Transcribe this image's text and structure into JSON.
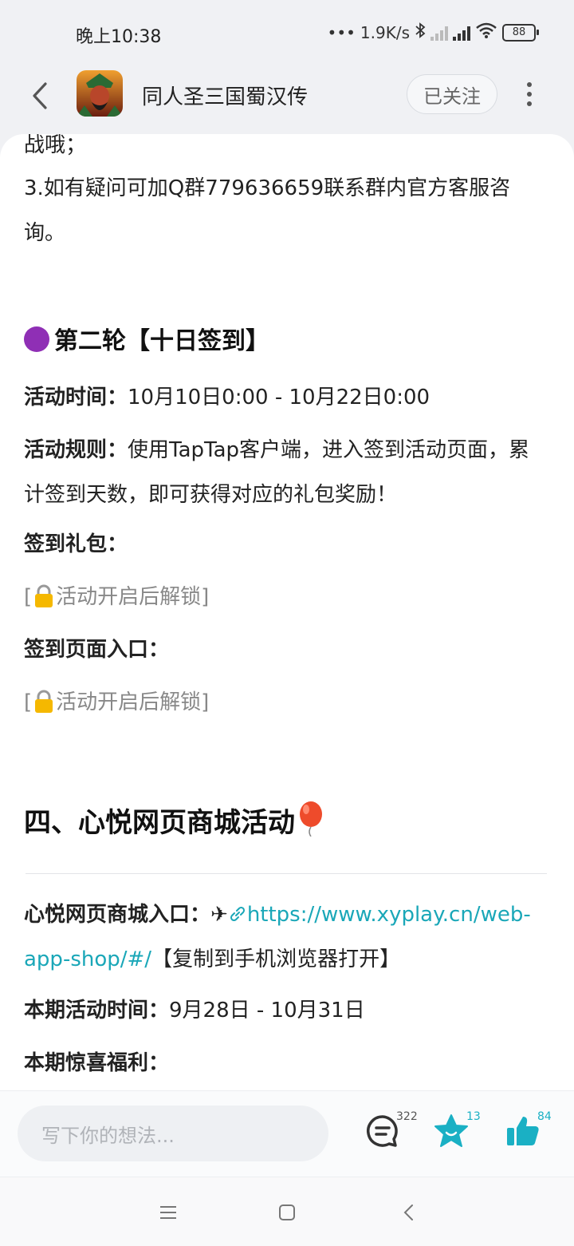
{
  "status_bar": {
    "time": "晚上10:38",
    "network_speed": "1.9K/s",
    "battery": "88"
  },
  "header": {
    "title": "同人圣三国蜀汉传",
    "follow_label": "已关注"
  },
  "content": {
    "cut_top_text": "战哦；",
    "note3": "3.如有疑问可加Q群779636659联系群内官方客服咨询。",
    "round2_title": "第二轮【十日签到】",
    "time_label": "活动时间：",
    "time_value": "10月10日0:00 - 10月22日0:00",
    "rules_label": "活动规则：",
    "rules_value": "使用TapTap客户端，进入签到活动页面，累计签到天数，即可获得对应的礼包奖励！",
    "gift_label": "签到礼包：",
    "locked_open": "[",
    "locked_text": "活动开启后解锁]",
    "entry_label": "签到页面入口：",
    "section4_title": "四、心悦网页商城活动",
    "shop_entry_label": "心悦网页商城入口：",
    "shop_link": "https://www.xyplay.cn/web-app-shop/#/",
    "shop_hint": "【复制到手机浏览器打开】",
    "period_label": "本期活动时间：",
    "period_value": "9月28日 - 10月31日",
    "bonus_label": "本期惊喜福利："
  },
  "action_bar": {
    "input_placeholder": "写下你的想法...",
    "comment_count": "322",
    "favorite_count": "13",
    "like_count": "84"
  },
  "colors": {
    "accent": "#1aa7b8",
    "round_dot": "#8f2fb5"
  }
}
